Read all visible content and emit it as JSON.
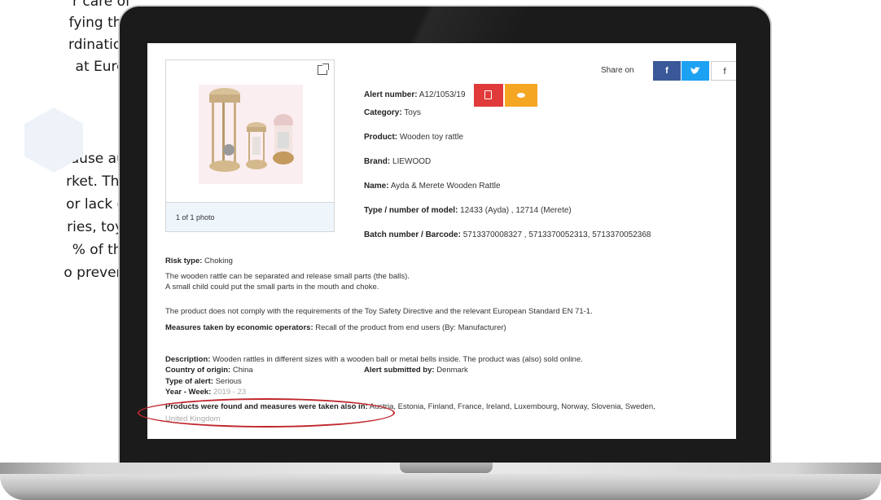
{
  "background_text": {
    "lines": [
      "r care of",
      "fying the",
      "rdination",
      "at Euro-",
      "ause au-",
      "rket. This",
      "or lack of",
      "ries, toys",
      "% of the",
      "o prevent"
    ]
  },
  "photo": {
    "caption": "1 of 1 photo"
  },
  "share": {
    "label": "Share on",
    "facebook": "f",
    "twitter": "t",
    "more": "f"
  },
  "alert": {
    "number_label": "Alert number:",
    "number_value": "A12/1053/19",
    "category_label": "Category:",
    "category_value": "Toys",
    "product_label": "Product:",
    "product_value": "Wooden toy rattle",
    "brand_label": "Brand:",
    "brand_value": "LIEWOOD",
    "name_label": "Name:",
    "name_value": "Ayda & Merete Wooden Rattle",
    "type_label": "Type / number of model:",
    "type_value": "12433 (Ayda) , 12714 (Merete)",
    "batch_label": "Batch number / Barcode:",
    "batch_value": "5713370008327 , 5713370052313, 5713370052368"
  },
  "risk": {
    "type_label": "Risk type:",
    "type_value": "Choking",
    "line1": "The wooden rattle can be separated and release small parts (the balls).",
    "line2": "A small child could put the small parts in the mouth and choke.",
    "compliance": "The product does not comply with the requirements of the Toy Safety Directive and the relevant European Standard EN 71-1.",
    "measures_label": "Measures taken by economic operators:",
    "measures_value": "Recall of the product from end users (By: Manufacturer)"
  },
  "details": {
    "description_label": "Description:",
    "description_value": "Wooden rattles in different sizes with a wooden ball or metal bells inside. The product was (also) sold online.",
    "country_label": "Country of origin:",
    "country_value": "China",
    "submitted_label": "Alert submitted by:",
    "submitted_value": "Denmark",
    "alert_type_label": "Type of alert:",
    "alert_type_value": "Serious",
    "year_label": "Year - Week:",
    "year_value": "2019 - 23",
    "found_label": "Products were found and measures were taken also in:",
    "found_value": "Austria, Estonia, Finland, France, Ireland, Luxembourg, Norway, Slovenia, Sweden,",
    "found_value2": "United Kingdom"
  },
  "colors": {
    "pdf_button": "#e03a3a",
    "eye_button": "#f5a623",
    "facebook": "#3b5998",
    "twitter": "#1da1f2",
    "highlight_circle": "#c0262d"
  }
}
